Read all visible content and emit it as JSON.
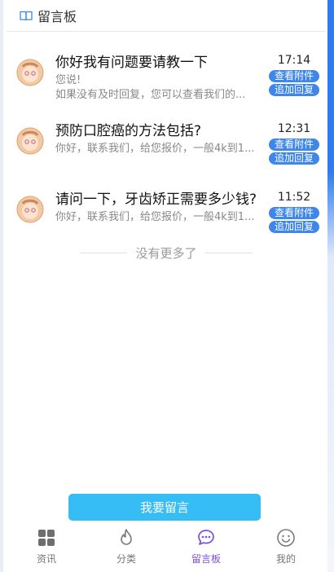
{
  "header": {
    "title": "留言板",
    "icon": "book-icon"
  },
  "messages": [
    {
      "title": "你好我有问题要请教一下",
      "preview_lines": [
        "您说!",
        "如果没有及时回复，您可以查看我们的..."
      ],
      "time": "17:14",
      "view_attachment": "查看附件",
      "add_reply": "追加回复"
    },
    {
      "title": "预防口腔癌的方法包括?",
      "preview_lines": [
        "你好，联系我们，给您报价，一般4k到1..."
      ],
      "time": "12:31",
      "view_attachment": "查看附件",
      "add_reply": "追加回复"
    },
    {
      "title": "请问一下，牙齿矫正需要多少钱?",
      "preview_lines": [
        "你好，联系我们，给您报价，一般4k到1..."
      ],
      "time": "11:52",
      "view_attachment": "查看附件",
      "add_reply": "追加回复"
    }
  ],
  "no_more_text": "没有更多了",
  "post_button": "我要留言",
  "tabs": [
    {
      "label": "资讯",
      "icon": "grid-icon",
      "active": false
    },
    {
      "label": "分类",
      "icon": "flame-icon",
      "active": false
    },
    {
      "label": "留言板",
      "icon": "chat-icon",
      "active": true
    },
    {
      "label": "我的",
      "icon": "smile-icon",
      "active": false
    }
  ],
  "colors": {
    "accent": "#3f86ea",
    "post_button": "#36bdf5",
    "active_tab": "#7b4fe0"
  }
}
